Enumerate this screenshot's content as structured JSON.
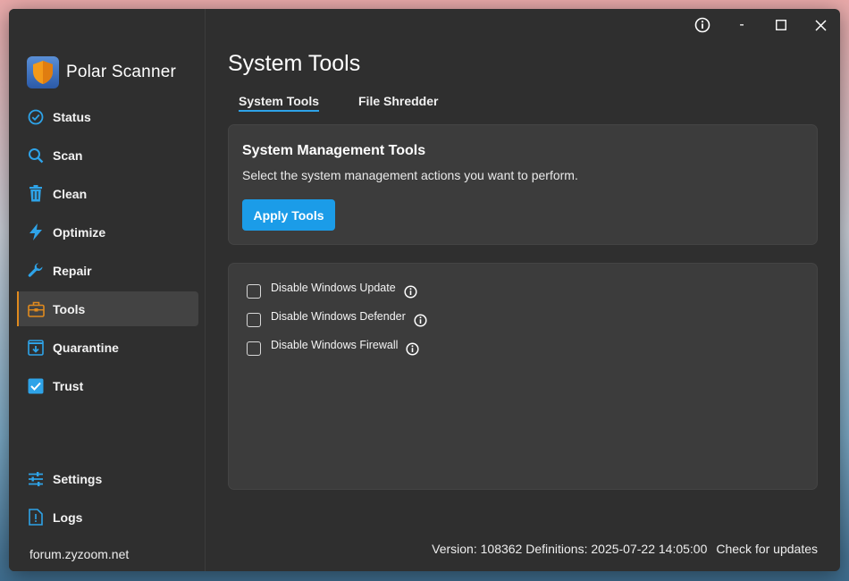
{
  "app": {
    "name": "Polar Scanner"
  },
  "titlebar": {
    "info_label": "i",
    "minimize_label": "-"
  },
  "sidebar": {
    "items": [
      {
        "label": "Status",
        "icon": "check-circle-icon"
      },
      {
        "label": "Scan",
        "icon": "search-icon"
      },
      {
        "label": "Clean",
        "icon": "trash-icon"
      },
      {
        "label": "Optimize",
        "icon": "lightning-icon"
      },
      {
        "label": "Repair",
        "icon": "wrench-icon"
      },
      {
        "label": "Tools",
        "icon": "toolbox-icon",
        "active": true
      },
      {
        "label": "Quarantine",
        "icon": "quarantine-box-icon"
      },
      {
        "label": "Trust",
        "icon": "checkbox-icon"
      }
    ],
    "bottom_items": [
      {
        "label": "Settings",
        "icon": "sliders-icon"
      },
      {
        "label": "Logs",
        "icon": "log-file-icon"
      }
    ],
    "forum_link": "forum.zyzoom.net"
  },
  "main": {
    "title": "System Tools",
    "tabs": [
      {
        "label": "System Tools",
        "active": true
      },
      {
        "label": "File Shredder",
        "active": false
      }
    ],
    "management_card": {
      "title": "System Management Tools",
      "description": "Select the system management actions you want to perform.",
      "apply_label": "Apply Tools"
    },
    "options": [
      {
        "label": "Disable Windows Update",
        "checked": false
      },
      {
        "label": "Disable Windows Defender",
        "checked": false
      },
      {
        "label": "Disable Windows Firewall",
        "checked": false
      }
    ]
  },
  "footer": {
    "version_text": "Version: 108362 Definitions: 2025-07-22 14:05:00",
    "check_updates": "Check for updates"
  },
  "colors": {
    "accent": "#1b9ce8",
    "active_indicator": "#e08a1e",
    "icon_blue": "#2ea3e8",
    "tools_icon": "#e08a1e"
  }
}
